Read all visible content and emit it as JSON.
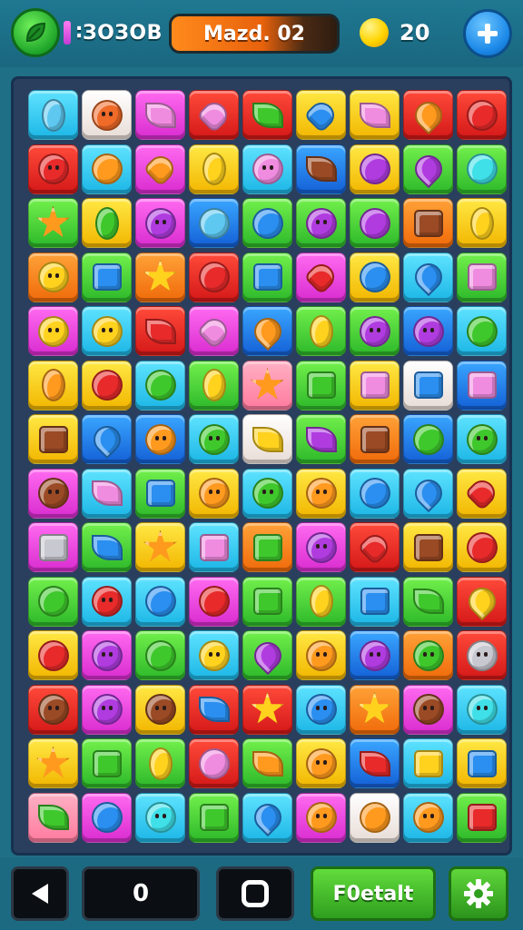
{
  "header": {
    "score": "∶ЗОЗОВ",
    "level": "Mazd. 02",
    "coins": "20",
    "logo_icon": "leaf-logo-icon",
    "coin_icon": "coin-icon",
    "add_icon": "plus-icon"
  },
  "footer": {
    "back_icon": "back-triangle-icon",
    "counter": "0",
    "circle_icon": "rounded-square-icon",
    "detail_label": "F0etalt",
    "settings_icon": "gear-icon"
  },
  "colors": {
    "background": "#1f6f86",
    "board": "#2a3f5e",
    "accent_orange": "#ff8a1c",
    "accent_green": "#3fbf28",
    "accent_blue": "#1b88e8"
  },
  "board": {
    "columns": 9,
    "rows": [
      [
        [
          "c",
          "bw",
          "oval"
        ],
        [
          "w",
          "or",
          "face"
        ],
        [
          "m",
          "pk",
          "leaf"
        ],
        [
          "r",
          "pk",
          "heart"
        ],
        [
          "r",
          "gr",
          "leaf"
        ],
        [
          "y",
          "bl",
          "heart"
        ],
        [
          "y",
          "pk",
          "leaf"
        ],
        [
          "r",
          "og",
          "drop"
        ],
        [
          "r",
          "rd",
          "circle"
        ]
      ],
      [
        [
          "r",
          "rd",
          "face"
        ],
        [
          "c",
          "og",
          "circle"
        ],
        [
          "m",
          "og",
          "heart"
        ],
        [
          "y",
          "yl",
          "oval"
        ],
        [
          "c",
          "pk",
          "face"
        ],
        [
          "b",
          "br",
          "leaf"
        ],
        [
          "y",
          "pu",
          "circle"
        ],
        [
          "g",
          "pu",
          "drop"
        ],
        [
          "g",
          "cy",
          "circle"
        ]
      ],
      [
        [
          "g",
          "og",
          "star"
        ],
        [
          "y",
          "gr",
          "oval"
        ],
        [
          "m",
          "pu",
          "face"
        ],
        [
          "b",
          "bw",
          "circle"
        ],
        [
          "g",
          "bl",
          "circle"
        ],
        [
          "g",
          "pu",
          "face"
        ],
        [
          "g",
          "pu",
          "circle"
        ],
        [
          "o",
          "br",
          "box"
        ],
        [
          "y",
          "yl",
          "oval"
        ]
      ],
      [
        [
          "o",
          "yl",
          "face"
        ],
        [
          "g",
          "bl",
          "box"
        ],
        [
          "o",
          "yl",
          "star"
        ],
        [
          "r",
          "rd",
          "circle"
        ],
        [
          "g",
          "bl",
          "box"
        ],
        [
          "m",
          "rd",
          "heart"
        ],
        [
          "y",
          "bl",
          "circle"
        ],
        [
          "c",
          "bl",
          "drop"
        ],
        [
          "g",
          "pk",
          "box"
        ]
      ],
      [
        [
          "m",
          "yl",
          "face"
        ],
        [
          "c",
          "yl",
          "face"
        ],
        [
          "r",
          "rd",
          "leaf"
        ],
        [
          "m",
          "pk",
          "heart"
        ],
        [
          "b",
          "og",
          "drop"
        ],
        [
          "g",
          "yl",
          "oval"
        ],
        [
          "g",
          "pu",
          "face"
        ],
        [
          "b",
          "pu",
          "face"
        ],
        [
          "c",
          "gr",
          "circle"
        ]
      ],
      [
        [
          "y",
          "og",
          "oval"
        ],
        [
          "y",
          "rd",
          "circle"
        ],
        [
          "c",
          "gr",
          "circle"
        ],
        [
          "g",
          "yl",
          "oval"
        ],
        [
          "p",
          "og",
          "star"
        ],
        [
          "g",
          "gr",
          "box"
        ],
        [
          "y",
          "pk",
          "box"
        ],
        [
          "w",
          "bl",
          "box"
        ],
        [
          "b",
          "pk",
          "box"
        ]
      ],
      [
        [
          "y",
          "br",
          "box"
        ],
        [
          "b",
          "bl",
          "drop"
        ],
        [
          "b",
          "og",
          "face"
        ],
        [
          "c",
          "gr",
          "face"
        ],
        [
          "w",
          "yl",
          "leaf"
        ],
        [
          "g",
          "pu",
          "leaf"
        ],
        [
          "o",
          "br",
          "box"
        ],
        [
          "b",
          "gr",
          "circle"
        ],
        [
          "c",
          "gr",
          "face"
        ]
      ],
      [
        [
          "m",
          "br",
          "face"
        ],
        [
          "c",
          "pk",
          "leaf"
        ],
        [
          "g",
          "bl",
          "box"
        ],
        [
          "y",
          "og",
          "face"
        ],
        [
          "c",
          "gr",
          "face"
        ],
        [
          "y",
          "og",
          "face"
        ],
        [
          "c",
          "bl",
          "circle"
        ],
        [
          "c",
          "bl",
          "drop"
        ],
        [
          "y",
          "rd",
          "heart"
        ]
      ],
      [
        [
          "m",
          "gy",
          "box"
        ],
        [
          "g",
          "bl",
          "leaf"
        ],
        [
          "y",
          "og",
          "star"
        ],
        [
          "c",
          "pk",
          "box"
        ],
        [
          "o",
          "gr",
          "box"
        ],
        [
          "m",
          "pu",
          "face"
        ],
        [
          "r",
          "rd",
          "heart"
        ],
        [
          "y",
          "br",
          "box"
        ],
        [
          "y",
          "rd",
          "circle"
        ]
      ],
      [
        [
          "g",
          "gr",
          "circle"
        ],
        [
          "c",
          "rd",
          "face"
        ],
        [
          "c",
          "bl",
          "circle"
        ],
        [
          "m",
          "rd",
          "circle"
        ],
        [
          "g",
          "gr",
          "box"
        ],
        [
          "g",
          "yl",
          "oval"
        ],
        [
          "c",
          "bl",
          "box"
        ],
        [
          "g",
          "gr",
          "leaf"
        ],
        [
          "r",
          "yl",
          "drop"
        ]
      ],
      [
        [
          "y",
          "rd",
          "circle"
        ],
        [
          "m",
          "pu",
          "face"
        ],
        [
          "g",
          "gr",
          "circle"
        ],
        [
          "c",
          "yl",
          "face"
        ],
        [
          "g",
          "pu",
          "drop"
        ],
        [
          "y",
          "og",
          "face"
        ],
        [
          "b",
          "pu",
          "face"
        ],
        [
          "o",
          "gr",
          "face"
        ],
        [
          "r",
          "gy",
          "face"
        ]
      ],
      [
        [
          "r",
          "br",
          "face"
        ],
        [
          "m",
          "pu",
          "face"
        ],
        [
          "y",
          "br",
          "face"
        ],
        [
          "r",
          "bl",
          "leaf"
        ],
        [
          "r",
          "yl",
          "star"
        ],
        [
          "c",
          "bl",
          "face"
        ],
        [
          "o",
          "yl",
          "star"
        ],
        [
          "m",
          "br",
          "face"
        ],
        [
          "c",
          "cy",
          "face"
        ]
      ],
      [
        [
          "y",
          "og",
          "star"
        ],
        [
          "g",
          "gr",
          "box"
        ],
        [
          "g",
          "yl",
          "oval"
        ],
        [
          "r",
          "pk",
          "circle"
        ],
        [
          "g",
          "og",
          "leaf"
        ],
        [
          "y",
          "og",
          "face"
        ],
        [
          "b",
          "rd",
          "leaf"
        ],
        [
          "c",
          "yl",
          "box"
        ],
        [
          "y",
          "bl",
          "box"
        ]
      ],
      [
        [
          "p",
          "gr",
          "leaf"
        ],
        [
          "m",
          "bl",
          "circle"
        ],
        [
          "c",
          "cy",
          "face"
        ],
        [
          "g",
          "gr",
          "box"
        ],
        [
          "c",
          "bl",
          "drop"
        ],
        [
          "m",
          "og",
          "face"
        ],
        [
          "w",
          "og",
          "circle"
        ],
        [
          "c",
          "og",
          "face"
        ],
        [
          "g",
          "rd",
          "box"
        ]
      ]
    ]
  }
}
